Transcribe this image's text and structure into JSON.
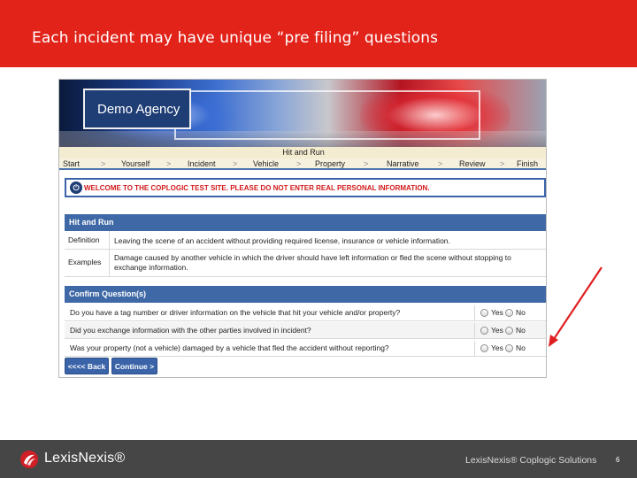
{
  "slide": {
    "title": "Each incident may have unique “pre filing” questions",
    "header_color": "#e2231a"
  },
  "app": {
    "agency_name": "Demo Agency",
    "wizard_title": "Hit and Run",
    "steps": [
      "Start",
      "Yourself",
      "Incident",
      "Vehicle",
      "Property",
      "Narrative",
      "Review",
      "Finish"
    ],
    "step_separator": ">",
    "warning_text": "WELCOME TO THE COPLOGIC TEST SITE. PLEASE DO NOT ENTER REAL PERSONAL INFORMATION.",
    "warning_icon": "info-icon",
    "definition_section": {
      "title": "Hit and Run",
      "rows": [
        {
          "label": "Definition",
          "value": "Leaving the scene of an accident without providing required license, insurance or vehicle information."
        },
        {
          "label": "Examples",
          "value": "Damage caused by another vehicle in which the driver should have left information or fled the scene without stopping to exchange information."
        }
      ]
    },
    "questions_section": {
      "title": "Confirm Question(s)",
      "yes_label": "Yes",
      "no_label": "No",
      "questions": [
        "Do you have a tag number or driver information on the vehicle that hit your vehicle and/or property?",
        "Did you exchange information with the other parties involved in incident?",
        "Was your property (not a vehicle) damaged by a vehicle that fled the accident without reporting?"
      ]
    },
    "buttons": {
      "back": "<<<< Back",
      "continue": "Continue >"
    },
    "accent_color": "#3f69a6",
    "warning_color": "#d21a1a"
  },
  "annotation": {
    "arrow_color": "#e02020"
  },
  "footer": {
    "logo_text": "LexisNexis®",
    "credit": "LexisNexis® Coplogic Solutions",
    "page_number": "6"
  }
}
